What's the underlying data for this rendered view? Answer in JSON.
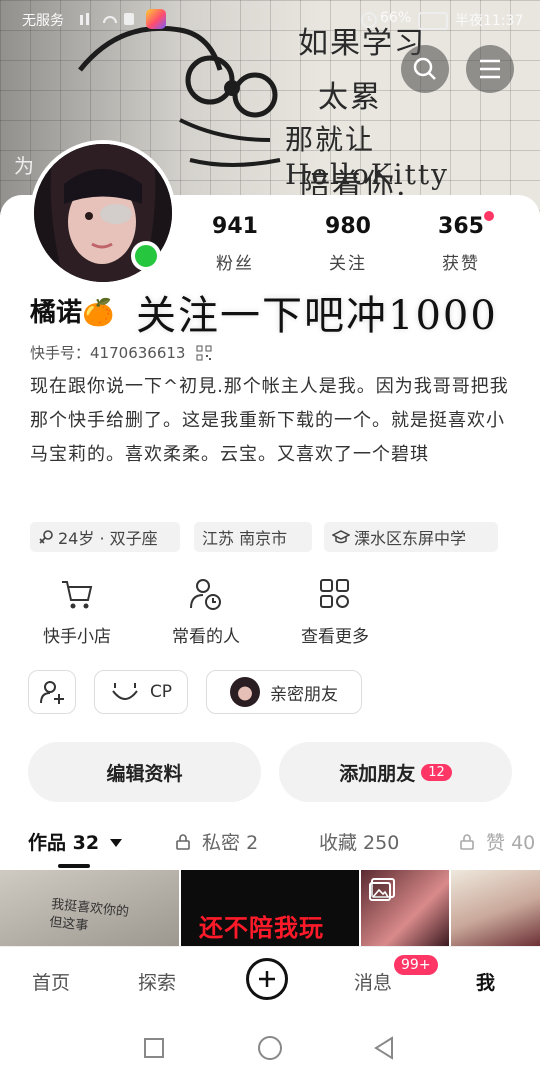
{
  "status_bar": {
    "carrier": "无服务",
    "battery": "66%",
    "time": "半夜11:37"
  },
  "cover": {
    "handwriting": [
      "如果学习",
      "太累",
      "那就让 HelloKitty",
      "陪着你."
    ],
    "edge_text": "为"
  },
  "header_icons": [
    "search-icon",
    "menu-icon"
  ],
  "profile": {
    "nickname": "橘诺",
    "nickname_emoji": "🍊",
    "sticker_text": "关注一下吧冲1000",
    "kuaishou_id_label": "快手号：",
    "kuaishou_id": "4170636613",
    "online": true,
    "bio": "现在跟你说一下^初見.那个帐主人是我。因为我哥哥把我那个快手给删了。这是我重新下载的一个。就是挺喜欢小马宝莉的。喜欢柔柔。云宝。又喜欢了一个碧琪"
  },
  "stats": [
    {
      "value": "941",
      "label": "粉丝"
    },
    {
      "value": "980",
      "label": "关注"
    },
    {
      "value": "365",
      "label": "获赞"
    }
  ],
  "tags": [
    {
      "text": "24岁 · 双子座",
      "icon": "female-icon"
    },
    {
      "text": "江苏 南京市",
      "icon": ""
    },
    {
      "text": "溧水区东屏中学",
      "icon": "school-icon"
    }
  ],
  "features": [
    {
      "label": "快手小店",
      "icon": "cart-icon"
    },
    {
      "label": "常看的人",
      "icon": "person-clock-icon"
    },
    {
      "label": "查看更多",
      "icon": "grid-icon"
    }
  ],
  "pills": {
    "add_friend_icon": "add-user-icon",
    "cp_label": "CP",
    "close_friend_label": "亲密朋友"
  },
  "actions": {
    "edit": "编辑资料",
    "add_friend": "添加朋友",
    "add_friend_badge": "12"
  },
  "tabs": [
    {
      "label": "作品 32",
      "active": true
    },
    {
      "label": "私密 2",
      "locked": true
    },
    {
      "label": "收藏 250"
    },
    {
      "label": "赞 40",
      "locked": true
    }
  ],
  "thumbnails": [
    {
      "text": "我挺喜欢你的\n但这事"
    },
    {
      "text": "还不陪我玩"
    },
    {
      "text": ""
    },
    {
      "text": ""
    }
  ],
  "bottom_nav": {
    "home": "首页",
    "explore": "探索",
    "messages": "消息",
    "messages_badge": "99+",
    "me": "我"
  },
  "colors": {
    "accent": "#fe3666",
    "online": "#27c63f"
  }
}
